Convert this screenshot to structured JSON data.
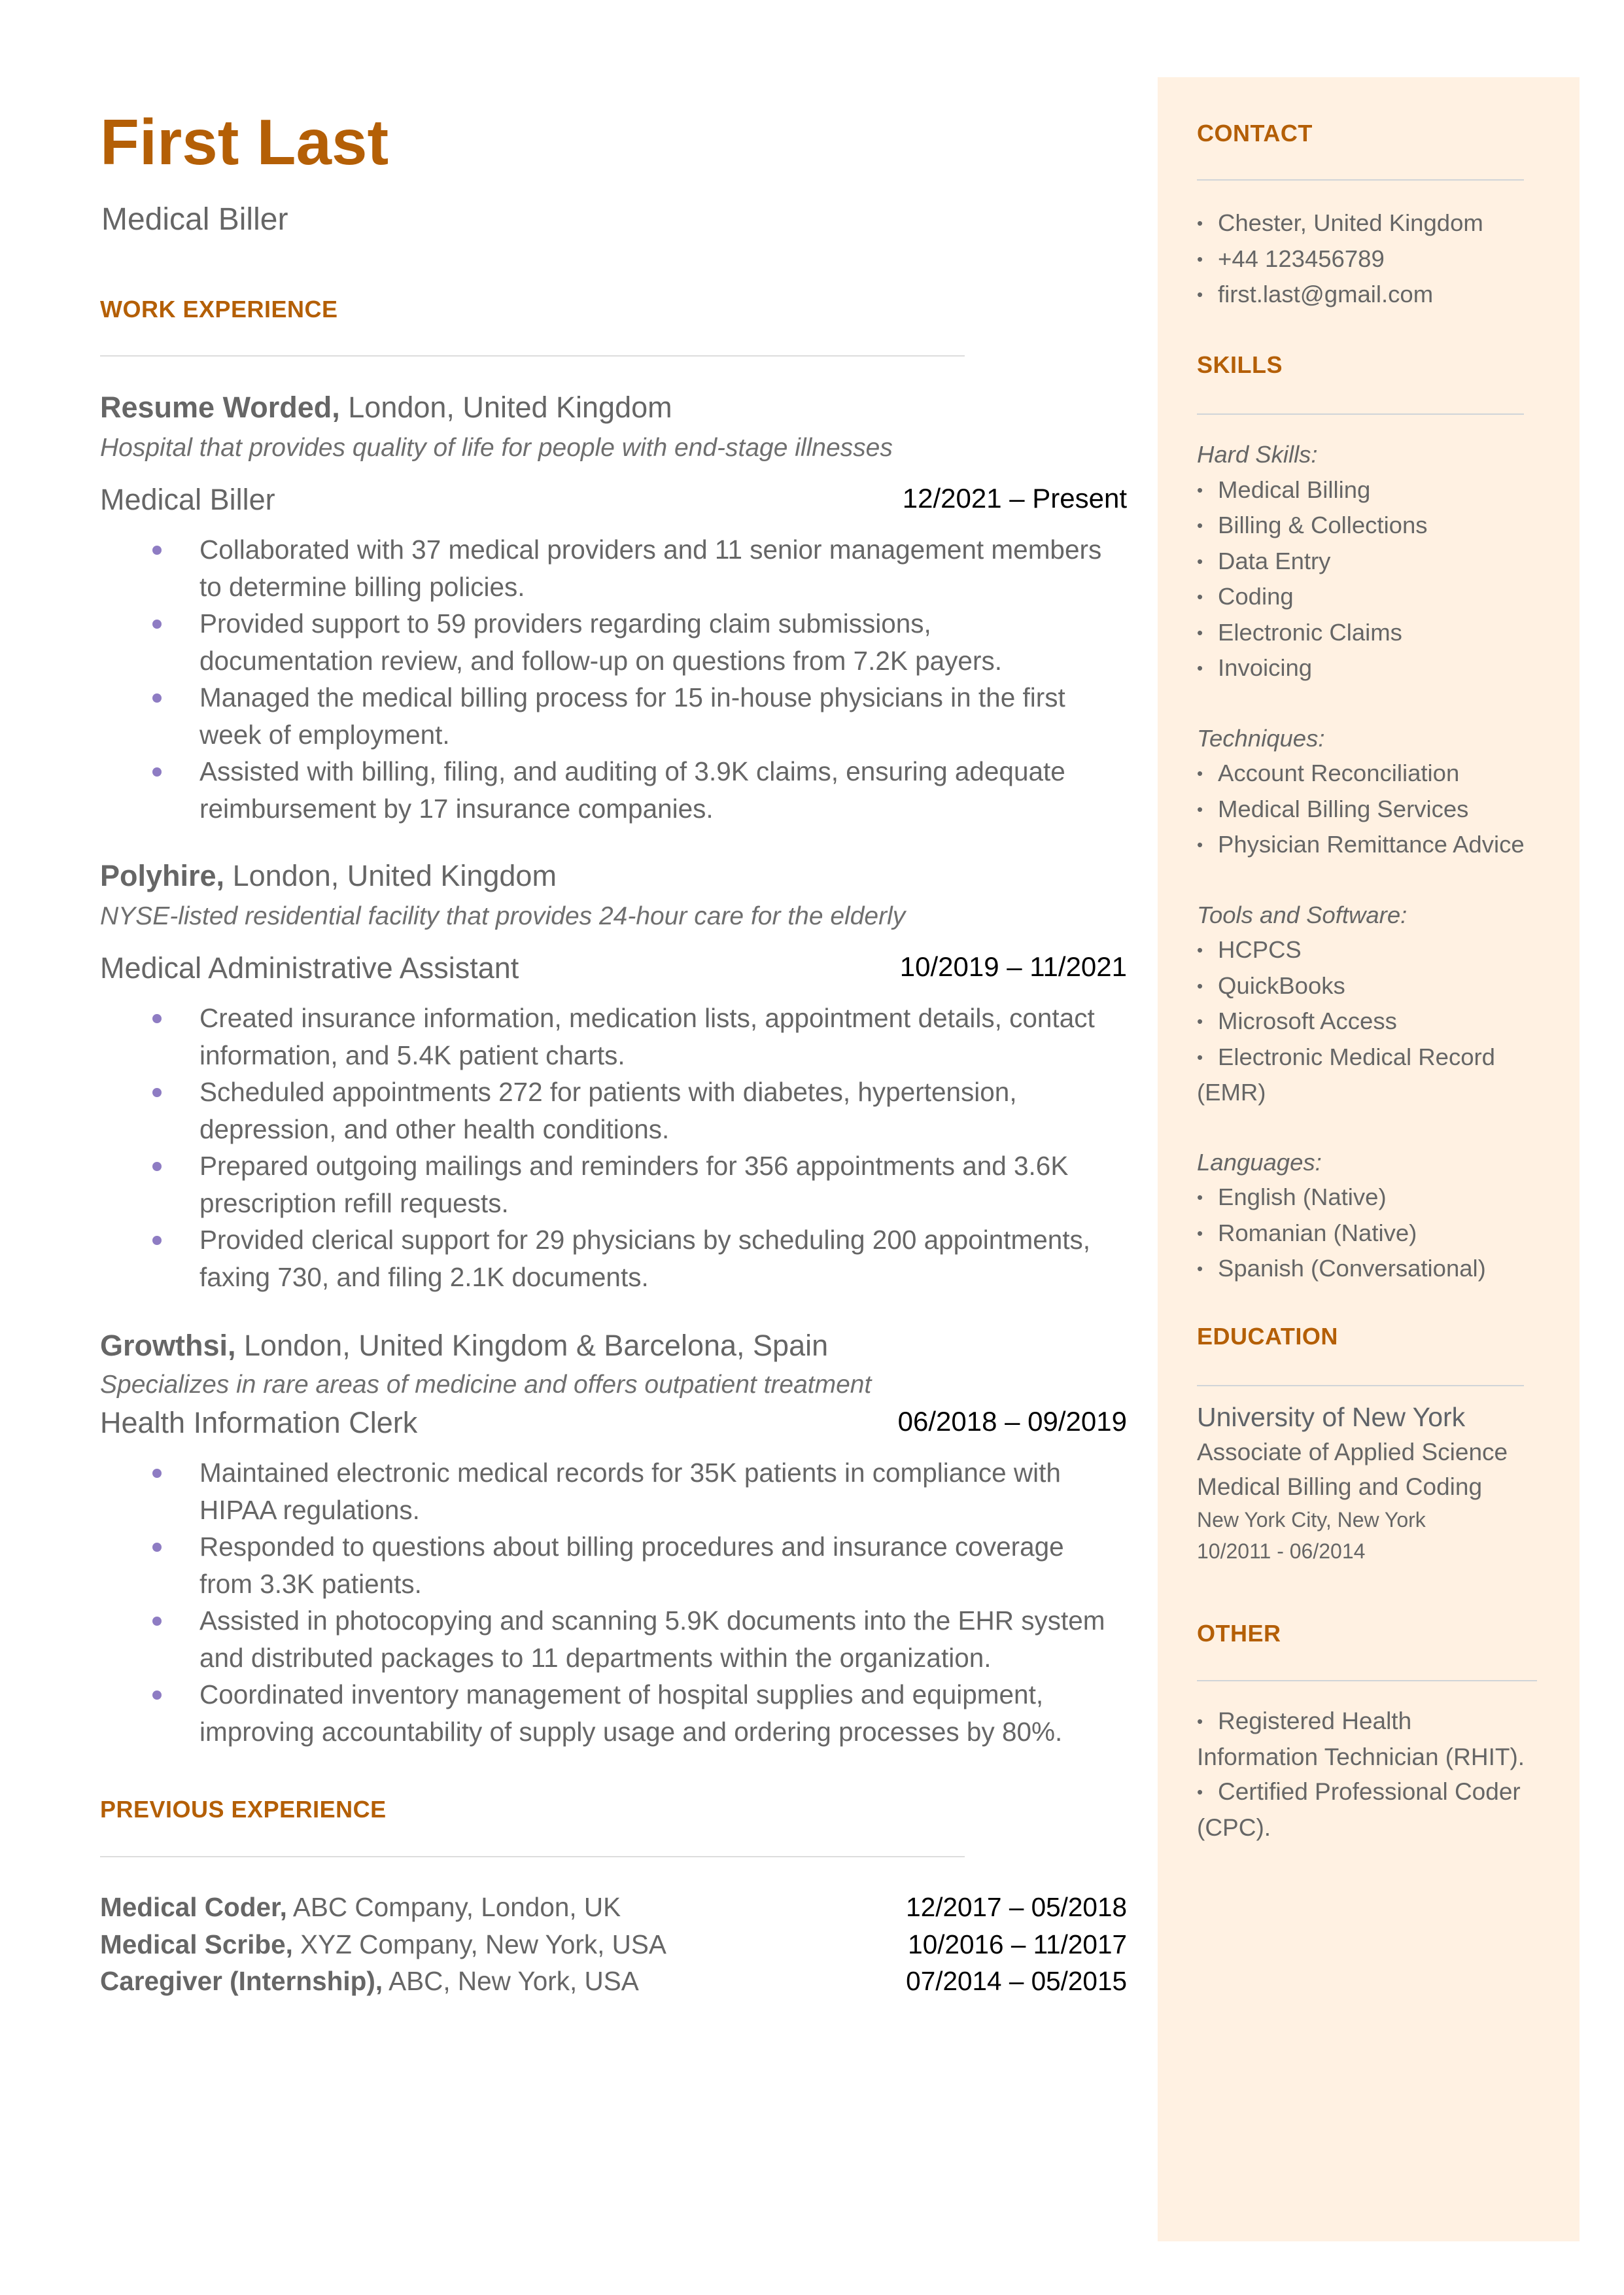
{
  "header": {
    "name": "First Last",
    "title": "Medical Biller"
  },
  "colors": {
    "accent": "#b45f06",
    "bullet": "#8e7cc3",
    "sidebar_bg": "#fff1e2",
    "text": "#666666"
  },
  "work_experience": {
    "heading": "WORK EXPERIENCE",
    "jobs": [
      {
        "company": "Resume Worded,",
        "location": "London, United Kingdom",
        "description": "Hospital that provides quality of life for people with end-stage illnesses",
        "title": "Medical Biller",
        "dates": "12/2021 – Present",
        "bullets": [
          [
            "Collaborated with 37 medical providers and 11 senior management members",
            "to determine billing policies."
          ],
          [
            "Provided support to 59 providers regarding claim submissions,",
            "documentation review, and follow-up on questions from 7.2K payers."
          ],
          [
            "Managed the medical billing process for 15 in-house physicians in the first",
            "week of employment."
          ],
          [
            "Assisted with billing, filing, and auditing of 3.9K claims, ensuring adequate",
            "reimbursement by 17 insurance companies."
          ]
        ]
      },
      {
        "company": "Polyhire,",
        "location": "London, United Kingdom",
        "description": "NYSE-listed residential facility that provides 24-hour care for the elderly",
        "title": "Medical Administrative Assistant",
        "dates": "10/2019 – 11/2021",
        "bullets": [
          [
            "Created insurance information, medication lists, appointment details, contact",
            "information, and 5.4K patient charts."
          ],
          [
            "Scheduled appointments 272 for patients with diabetes, hypertension,",
            "depression, and other health conditions."
          ],
          [
            "Prepared outgoing mailings and reminders for 356 appointments and 3.6K",
            "prescription refill requests."
          ],
          [
            "Provided clerical support for 29 physicians by scheduling 200 appointments,",
            "faxing 730, and filing 2.1K documents."
          ]
        ]
      },
      {
        "company": "Growthsi,",
        "location": "London, United Kingdom & Barcelona, Spain",
        "description": "Specializes in rare areas of medicine and offers outpatient treatment",
        "title": "Health Information Clerk",
        "dates": "06/2018 – 09/2019",
        "bullets": [
          [
            "Maintained electronic medical records for 35K patients in compliance with",
            "HIPAA regulations."
          ],
          [
            "Responded to questions about billing procedures and insurance coverage",
            "from 3.3K patients."
          ],
          [
            "Assisted in photocopying and scanning 5.9K documents into the EHR system",
            "and distributed packages to 11 departments within the organization."
          ],
          [
            "Coordinated inventory management of hospital supplies and equipment,",
            "improving accountability of supply usage and ordering processes by 80%."
          ]
        ]
      }
    ]
  },
  "previous_experience": {
    "heading": "PREVIOUS EXPERIENCE",
    "items": [
      {
        "role": "Medical Coder,",
        "detail": "ABC Company, London, UK",
        "dates": "12/2017 – 05/2018"
      },
      {
        "role": "Medical Scribe,",
        "detail": "XYZ Company, New York, USA",
        "dates": "10/2016 – 11/2017"
      },
      {
        "role": "Caregiver (Internship),",
        "detail": "ABC, New York, USA",
        "dates": "07/2014 – 05/2015"
      }
    ]
  },
  "sidebar": {
    "contact": {
      "heading": "CONTACT",
      "items": [
        "Chester, United Kingdom",
        "+44 123456789",
        "first.last@gmail.com"
      ]
    },
    "skills": {
      "heading": "SKILLS",
      "groups": [
        {
          "label": "Hard Skills:",
          "items": [
            "Medical Billing",
            "Billing & Collections",
            "Data Entry",
            "Coding",
            "Electronic Claims",
            "Invoicing"
          ]
        },
        {
          "label": "Techniques:",
          "items": [
            "Account Reconciliation",
            "Medical Billing Services",
            "Physician Remittance Advice"
          ]
        },
        {
          "label": "Tools and Software:",
          "items": [
            "HCPCS",
            "QuickBooks",
            "Microsoft Access",
            "Electronic Medical Record",
            "(EMR)"
          ]
        },
        {
          "label": "Languages:",
          "items": [
            "English (Native)",
            "Romanian (Native)",
            "Spanish (Conversational)"
          ]
        }
      ]
    },
    "education": {
      "heading": "EDUCATION",
      "school": "University of New York",
      "degree": "Associate of Applied Science",
      "field": "Medical Billing and Coding",
      "location": "New York City, New York",
      "dates": "10/2011 - 06/2014"
    },
    "other": {
      "heading": "OTHER",
      "lines": [
        "Registered Health",
        "Information Technician (RHIT).",
        "Certified Professional Coder",
        "(CPC)."
      ]
    }
  }
}
